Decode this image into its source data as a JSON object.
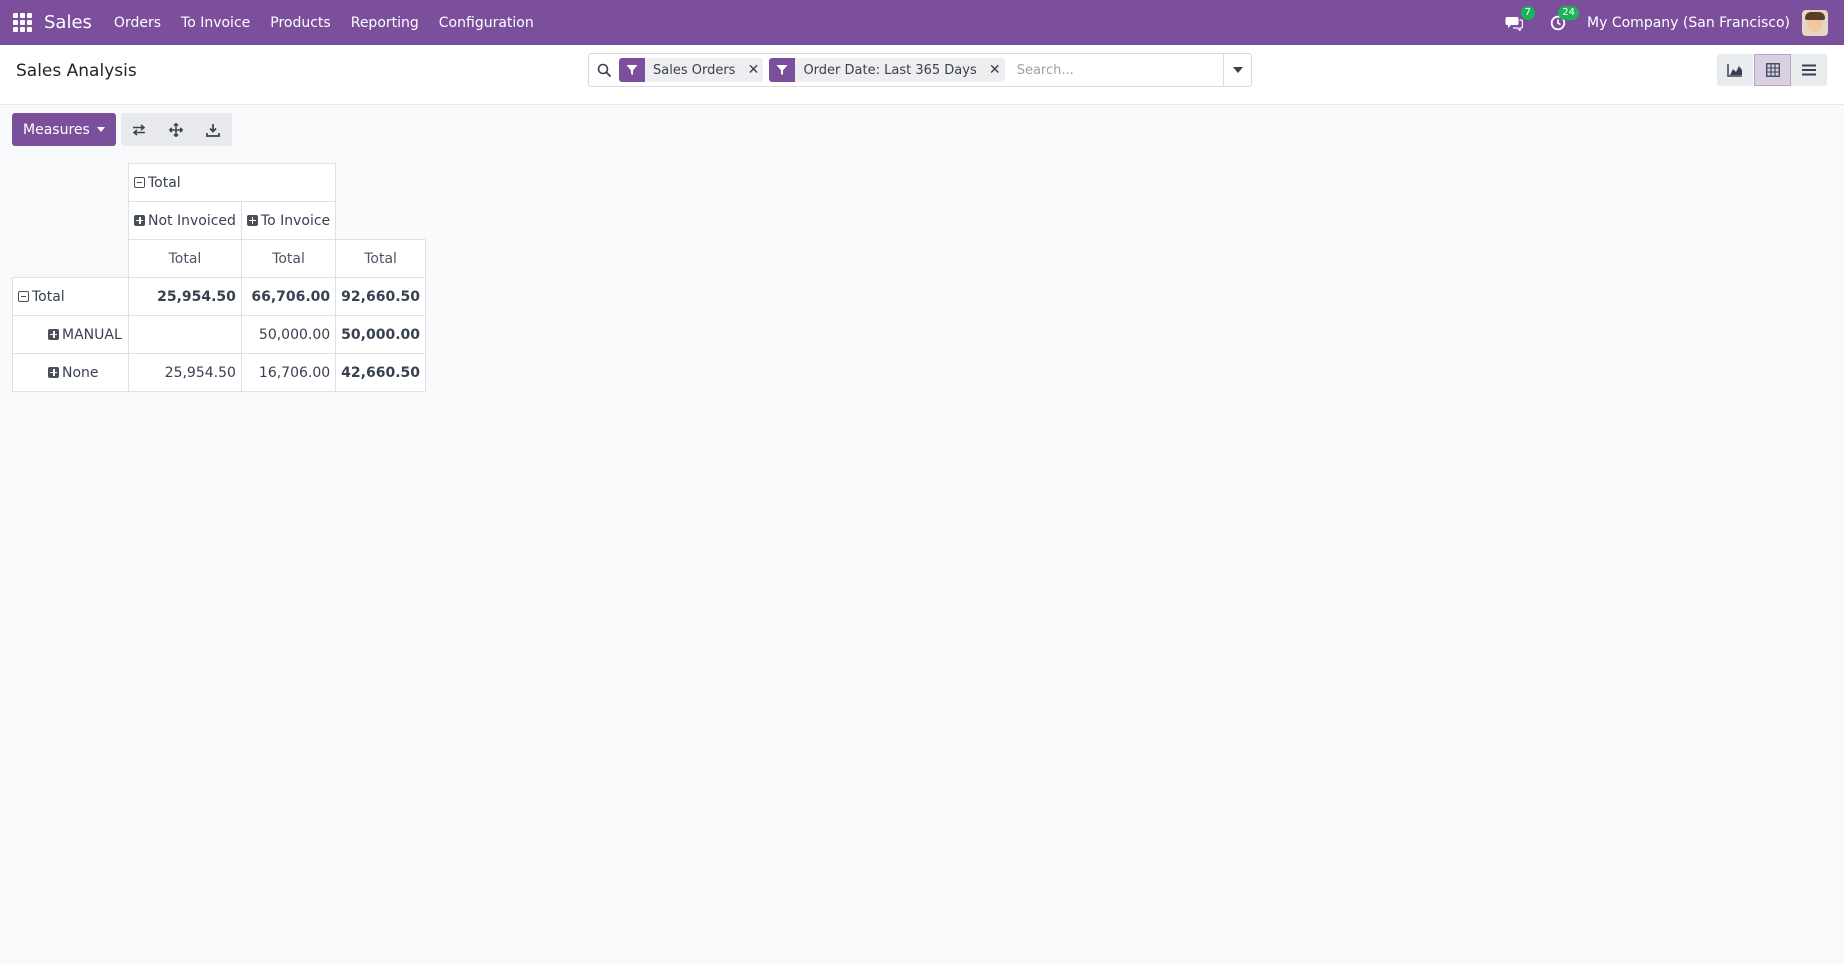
{
  "navbar": {
    "brand": "Sales",
    "menu": [
      "Orders",
      "To Invoice",
      "Products",
      "Reporting",
      "Configuration"
    ],
    "messages_count": "7",
    "activities_count": "24",
    "company": "My Company (San Francisco)"
  },
  "control_panel": {
    "title": "Sales Analysis",
    "facets": [
      {
        "label": "Sales Orders"
      },
      {
        "label": "Order Date: Last 365 Days"
      }
    ],
    "search_placeholder": "Search..."
  },
  "toolbar": {
    "measures_label": "Measures"
  },
  "pivot": {
    "col_total_label": "Total",
    "col_groups": [
      "Not Invoiced",
      "To Invoice"
    ],
    "measure_headers": [
      "Total",
      "Total",
      "Total"
    ],
    "rows": [
      {
        "label": "Total",
        "values": [
          "25,954.50",
          "66,706.00",
          "92,660.50"
        ]
      },
      {
        "label": "MANUAL",
        "values": [
          "",
          "50,000.00",
          "50,000.00"
        ]
      },
      {
        "label": "None",
        "values": [
          "25,954.50",
          "16,706.00",
          "42,660.50"
        ]
      }
    ]
  },
  "colors": {
    "brand": "#7c4f9c",
    "badge": "#1cb459"
  }
}
